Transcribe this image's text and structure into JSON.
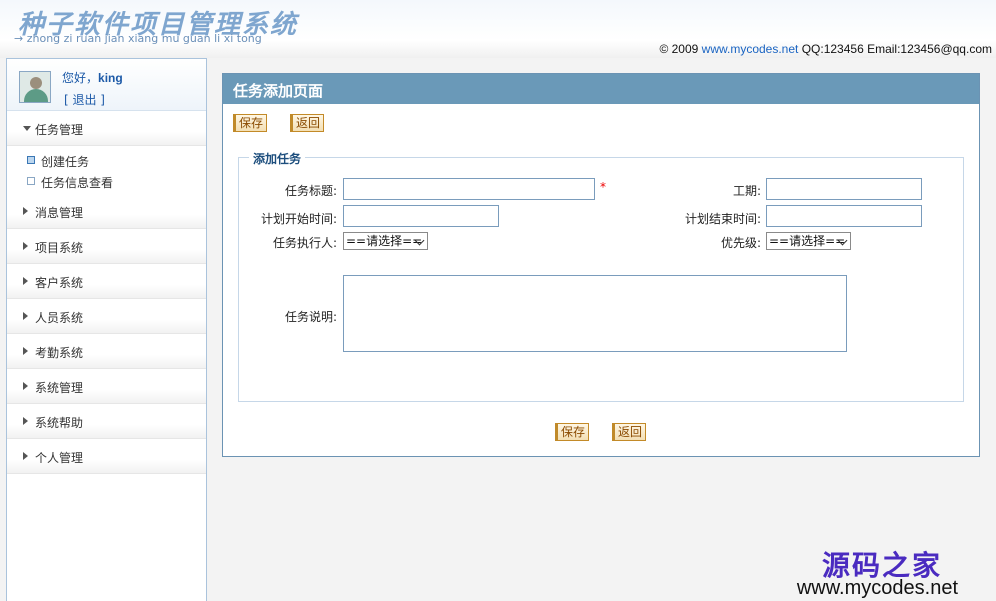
{
  "header": {
    "title": "种子软件项目管理系统",
    "subtitle": "→ zhong zi ruan jian xiang mu guan li xi tong",
    "copyright_prefix": "© 2009 ",
    "site_link": "www.mycodes.net",
    "contact": " QQ:123456 Email:123456@qq.com"
  },
  "user": {
    "greeting_prefix": "您好，",
    "name": "king",
    "logout": "[ 退出 ]"
  },
  "sidebar": {
    "groups": [
      {
        "label": "任务管理",
        "expanded": true,
        "items": [
          {
            "label": "创建任务",
            "active": true
          },
          {
            "label": "任务信息查看",
            "active": false
          }
        ]
      },
      {
        "label": "消息管理"
      },
      {
        "label": "项目系统"
      },
      {
        "label": "客户系统"
      },
      {
        "label": "人员系统"
      },
      {
        "label": "考勤系统"
      },
      {
        "label": "系统管理"
      },
      {
        "label": "系统帮助"
      },
      {
        "label": "个人管理"
      }
    ]
  },
  "panel": {
    "title": "任务添加页面",
    "save": "保存",
    "back": "返回",
    "legend": "添加任务",
    "fields": {
      "task_title": {
        "label": "任务标题:",
        "value": "",
        "required_mark": "*"
      },
      "duration": {
        "label": "工期:",
        "value": ""
      },
      "plan_start": {
        "label": "计划开始时间:",
        "value": ""
      },
      "plan_end": {
        "label": "计划结束时间:",
        "value": ""
      },
      "executor": {
        "label": "任务执行人:",
        "selected": "==请选择=="
      },
      "priority": {
        "label": "优先级:",
        "selected": "==请选择=="
      },
      "description": {
        "label": "任务说明:",
        "value": ""
      }
    }
  },
  "watermark": {
    "cn": "源码之家",
    "en": "www.mycodes.net"
  }
}
